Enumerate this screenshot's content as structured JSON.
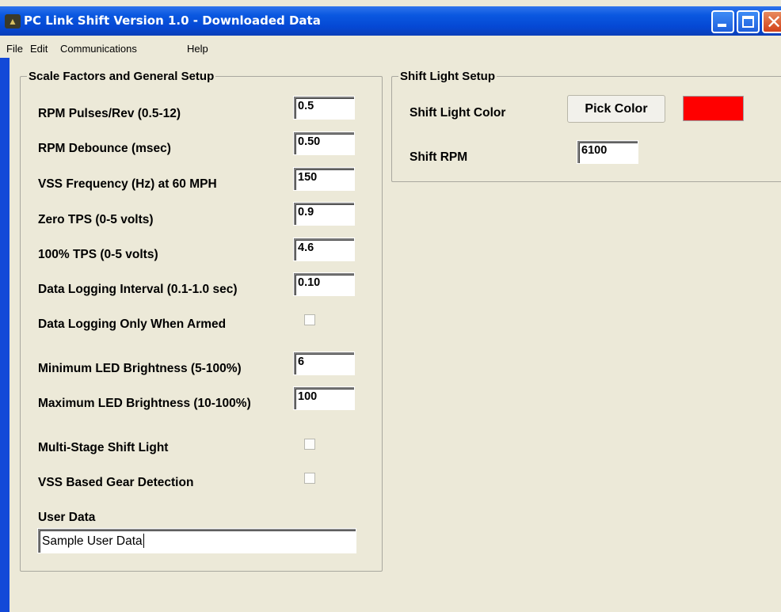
{
  "window": {
    "title": "PC Link Shift Version 1.0 - Downloaded Data",
    "icon": "app-logo-icon"
  },
  "menu": [
    "File",
    "Edit",
    "Communications",
    "Help"
  ],
  "scale_group": {
    "legend": "Scale Factors and General Setup",
    "fields": [
      {
        "label": "RPM Pulses/Rev (0.5-12)",
        "value": "0.5"
      },
      {
        "label": "RPM Debounce (msec)",
        "value": "0.50"
      },
      {
        "label": "VSS Frequency (Hz)  at 60 MPH",
        "value": "150"
      },
      {
        "label": "Zero TPS (0-5 volts)",
        "value": "0.9"
      },
      {
        "label": "100% TPS (0-5 volts)",
        "value": "4.6"
      },
      {
        "label": "Data Logging Interval (0.1-1.0 sec)",
        "value": "0.10"
      }
    ],
    "logging_armed": {
      "label": "Data Logging Only When Armed",
      "checked": false
    },
    "brightness": [
      {
        "label": "Minimum LED Brightness (5-100%)",
        "value": "6"
      },
      {
        "label": "Maximum LED Brightness (10-100%)",
        "value": "100"
      }
    ],
    "multi_stage": {
      "label": "Multi-Stage Shift Light",
      "checked": false
    },
    "vss_gear": {
      "label": "VSS Based Gear Detection",
      "checked": false
    },
    "user_data": {
      "label": "User Data",
      "value": "Sample User Data"
    }
  },
  "shift_group": {
    "legend": "Shift Light Setup",
    "color_label": "Shift Light Color",
    "pick_color_label": "Pick Color",
    "color": "#ff0000",
    "rpm_label": "Shift RPM",
    "rpm_value": "6100"
  }
}
